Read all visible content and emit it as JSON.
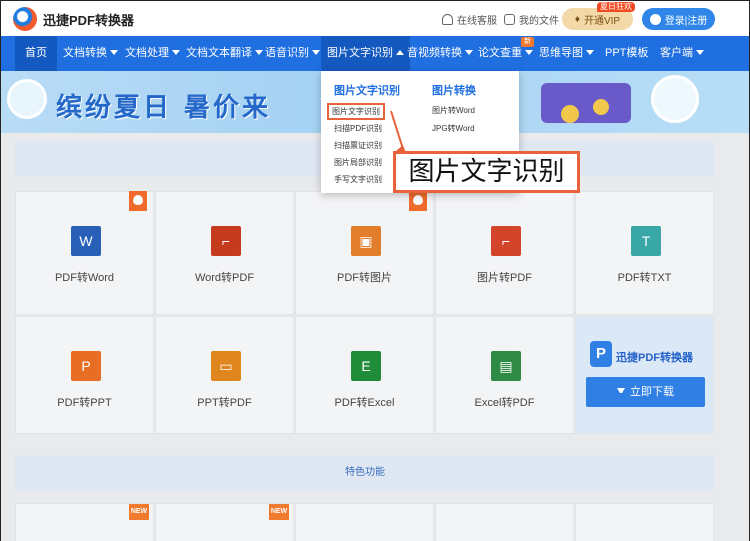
{
  "header": {
    "brand": "迅捷PDF转换器",
    "service_label": "在线客服",
    "files_label": "我的文件",
    "vip_label": "开通VIP",
    "vip_badge": "夏日狂欢",
    "login_label": "登录|注册"
  },
  "nav": {
    "items": [
      {
        "label": "首页"
      },
      {
        "label": "文档转换"
      },
      {
        "label": "文档处理"
      },
      {
        "label": "文档文本翻译"
      },
      {
        "label": "语音识别"
      },
      {
        "label": "图片文字识别"
      },
      {
        "label": "音视频转换"
      },
      {
        "label": "论文查重"
      },
      {
        "label": "思维导图"
      },
      {
        "label": "PPT模板"
      },
      {
        "label": "客户端"
      }
    ],
    "new_tag": "新"
  },
  "banner": {
    "title": "缤纷夏日 暑价来"
  },
  "dropdown": {
    "col1_title": "图片文字识别",
    "col1_items": [
      "图片文字识别",
      "扫描PDF识别",
      "扫描票证识别",
      "图片局部识别",
      "手写文字识别"
    ],
    "col2_title": "图片转换",
    "col2_items": [
      "图片转Word",
      "JPG转Word"
    ]
  },
  "callout": {
    "text": "图片文字识别"
  },
  "tools": {
    "row1": [
      {
        "label": "PDF转Word",
        "glyph": "W",
        "color": "#2860b8",
        "hot": false
      },
      {
        "label": "Word转PDF",
        "glyph": "⌐",
        "color": "#c63a1d",
        "hot": true
      },
      {
        "label": "PDF转图片",
        "glyph": "▣",
        "color": "#e27d2b",
        "hot": false
      },
      {
        "label": "图片转PDF",
        "glyph": "⌐",
        "color": "#d3452a",
        "hot": true
      },
      {
        "label": "PDF转TXT",
        "glyph": "T",
        "color": "#3aa7a7",
        "hot": false
      }
    ],
    "row2": [
      {
        "label": "PDF转PPT",
        "glyph": "P",
        "color": "#e86e25"
      },
      {
        "label": "PPT转PDF",
        "glyph": "▭",
        "color": "#e0861f"
      },
      {
        "label": "PDF转Excel",
        "glyph": "E",
        "color": "#1f8c3a"
      },
      {
        "label": "Excel转PDF",
        "glyph": "▤",
        "color": "#2f8a45"
      }
    ]
  },
  "promo": {
    "logo_glyph": "P",
    "name": "迅捷PDF转换器",
    "download_label": "立即下载"
  },
  "features": {
    "title": "特色功能",
    "new_label": "NEW"
  }
}
